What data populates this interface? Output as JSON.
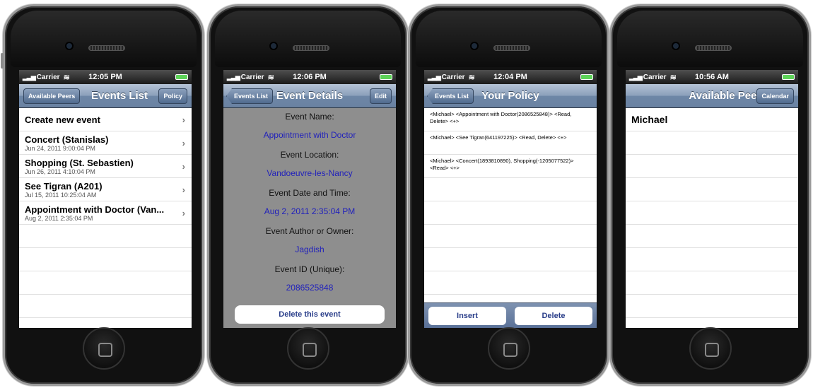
{
  "status": {
    "carrier": "Carrier"
  },
  "screens": [
    {
      "time": "12:05 PM",
      "nav": {
        "title": "Events List",
        "left": "Available Peers",
        "right": "Policy"
      },
      "create_label": "Create new event",
      "events": [
        {
          "title": "Concert (Stanislas)",
          "date": "Jun 24, 2011 9:00:04 PM"
        },
        {
          "title": "Shopping (St. Sebastien)",
          "date": "Jun 26, 2011 4:10:04 PM"
        },
        {
          "title": "See Tigran (A201)",
          "date": "Jul 15, 2011 10:25:04 AM"
        },
        {
          "title": "Appointment with Doctor (Van...",
          "date": "Aug 2, 2011 2:35:04 PM"
        }
      ]
    },
    {
      "time": "12:06 PM",
      "nav": {
        "title": "Event Details",
        "left": "Events List",
        "right": "Edit"
      },
      "fields": [
        {
          "label": "Event Name:",
          "value": "Appointment with Doctor"
        },
        {
          "label": "Event Location:",
          "value": "Vandoeuvre-les-Nancy"
        },
        {
          "label": "Event Date and Time:",
          "value": "Aug 2, 2011 2:35:04 PM"
        },
        {
          "label": "Event Author or Owner:",
          "value": "Jagdish"
        },
        {
          "label": "Event ID (Unique):",
          "value": "2086525848"
        }
      ],
      "delete_label": "Delete this event"
    },
    {
      "time": "12:04 PM",
      "nav": {
        "title": "Your Policy",
        "left": "Events List"
      },
      "policies": [
        "<Michael> <Appointment with Doctor(2086525848)> <Read, Delete> <+>",
        "<Michael> <See Tigran(641197225)> <Read, Delete> <+>",
        "<Michael> <Concert(1893810890), Shopping(-1205077522)> <Read> <+>"
      ],
      "insert_label": "Insert",
      "delete_label": "Delete"
    },
    {
      "time": "10:56 AM",
      "nav": {
        "title": "Available Peers",
        "right": "Calendar"
      },
      "peers": [
        "Michael"
      ]
    }
  ]
}
